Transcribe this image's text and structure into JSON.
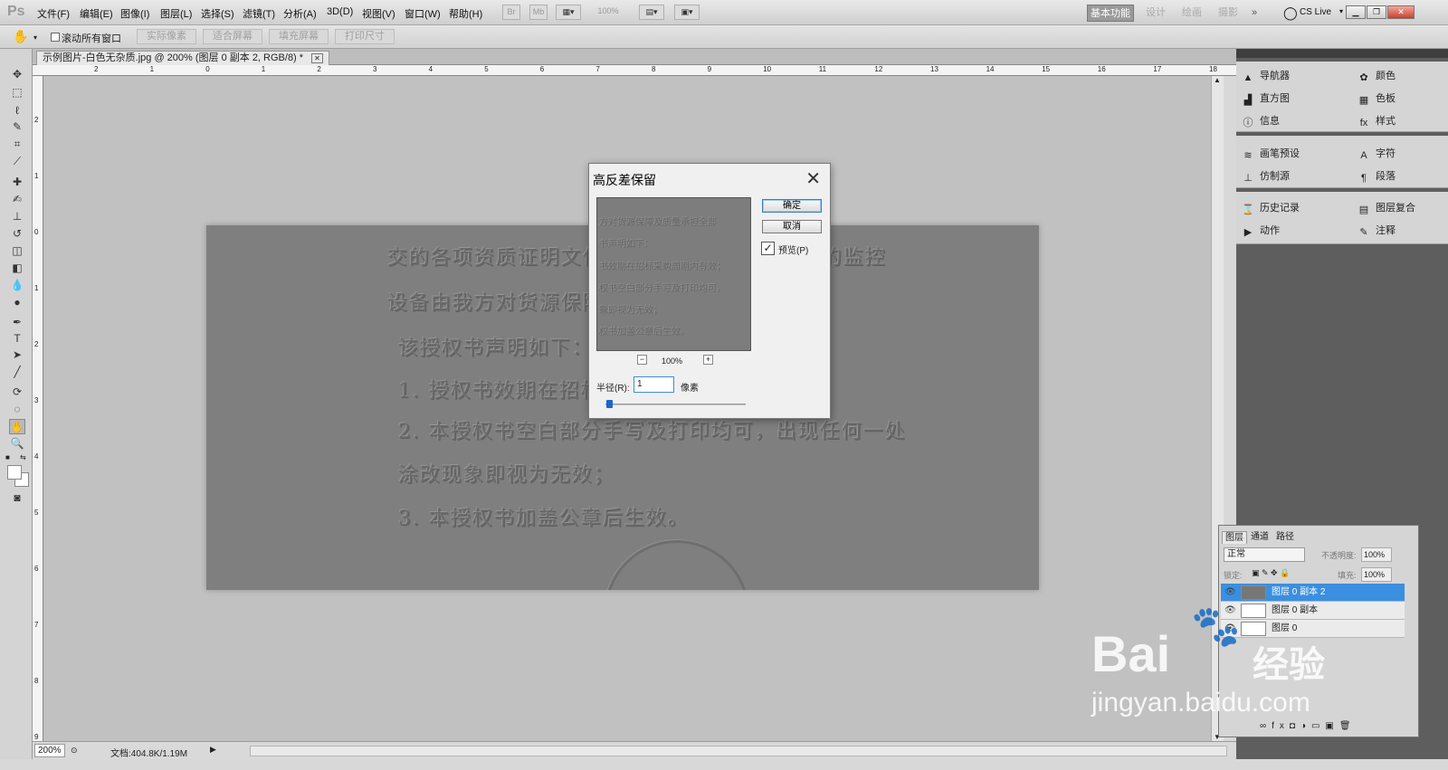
{
  "app": {
    "logo": "Ps"
  },
  "menu": [
    "文件(F)",
    "编辑(E)",
    "图像(I)",
    "图层(L)",
    "选择(S)",
    "滤镜(T)",
    "分析(A)",
    "3D(D)",
    "视图(V)",
    "窗口(W)",
    "帮助(H)"
  ],
  "menubar_tools": {
    "br": "Br",
    "mb": "Mb",
    "zoom": "100%"
  },
  "workspaces": {
    "active": "基本功能",
    "design": "设计",
    "painting": "绘画",
    "photography": "摄影",
    "more": "»"
  },
  "cs_live": "CS Live",
  "options_bar": {
    "scroll_all_label": "滚动所有窗口",
    "actual_pixels": "实际像素",
    "fit_screen": "适合屏幕",
    "fill_screen": "填充屏幕",
    "print_size": "打印尺寸"
  },
  "document": {
    "tab_title": "示例图片-白色无杂质.jpg @ 200% (图层 0 副本 2, RGB/8) *"
  },
  "ruler_h_labels": [
    "2",
    "1",
    "0",
    "1",
    "2",
    "3",
    "4",
    "5",
    "6",
    "7",
    "8",
    "9",
    "10",
    "11",
    "12",
    "13",
    "14",
    "15",
    "16",
    "17",
    "18"
  ],
  "ruler_v_labels": [
    "2",
    "1",
    "0",
    "1",
    "2",
    "3",
    "4",
    "5",
    "6",
    "7",
    "8",
    "9"
  ],
  "doc_text": [
    "交的各项资质证明文件均真实有效，质保期内的监控",
    "设备由我方对货源保障及质量承担全部责任。",
    "该授权书声明如下：",
    "1.  授权书效期在招标采购周期内有效；",
    "2.  本授权书空白部分手写及打印均可，出现任何一处",
    "涂改现象即视为无效；",
    "3.  本授权书加盖公章后生效。"
  ],
  "status": {
    "zoom": "200%",
    "doc_size": "文档:404.8K/1.19M"
  },
  "dialog": {
    "title": "高反差保留",
    "ok": "确定",
    "cancel": "取消",
    "preview_label": "预览(P)",
    "preview_checked": "✓",
    "zoom": "100%",
    "zoom_out": "−",
    "zoom_in": "+",
    "radius_label": "半径(R):",
    "radius_value": "1",
    "radius_unit": "像素",
    "preview_lines": [
      "方对货源保障及质量承担全部",
      "书声明如下：",
      "书效期在招标采购周期内有效；",
      "权书空白部分手写及打印均可，",
      "象即视为无效；",
      "权书加盖公章后生效。"
    ]
  },
  "panels": {
    "navigator": "导航器",
    "histogram": "直方图",
    "info": "信息",
    "color": "颜色",
    "swatches": "色板",
    "styles": "样式",
    "brush_presets": "画笔预设",
    "clone_source": "仿制源",
    "character": "字符",
    "paragraph": "段落",
    "history": "历史记录",
    "actions": "动作",
    "layer_comps": "图层复合",
    "notes": "注释"
  },
  "layers_panel": {
    "tabs": [
      "图层",
      "通道",
      "路径"
    ],
    "blend_mode": "正常",
    "opacity_label": "不透明度:",
    "opacity_value": "100%",
    "lock_label": "锁定:",
    "fill_label": "填充:",
    "fill_value": "100%",
    "layers": [
      {
        "name": "图层 0 副本 2",
        "selected": true
      },
      {
        "name": "图层 0 副本",
        "selected": false
      },
      {
        "name": "图层 0",
        "selected": false
      }
    ]
  },
  "watermark": {
    "brand": "Bai",
    "brand2": "经验",
    "url": "jingyan.baidu.com"
  }
}
